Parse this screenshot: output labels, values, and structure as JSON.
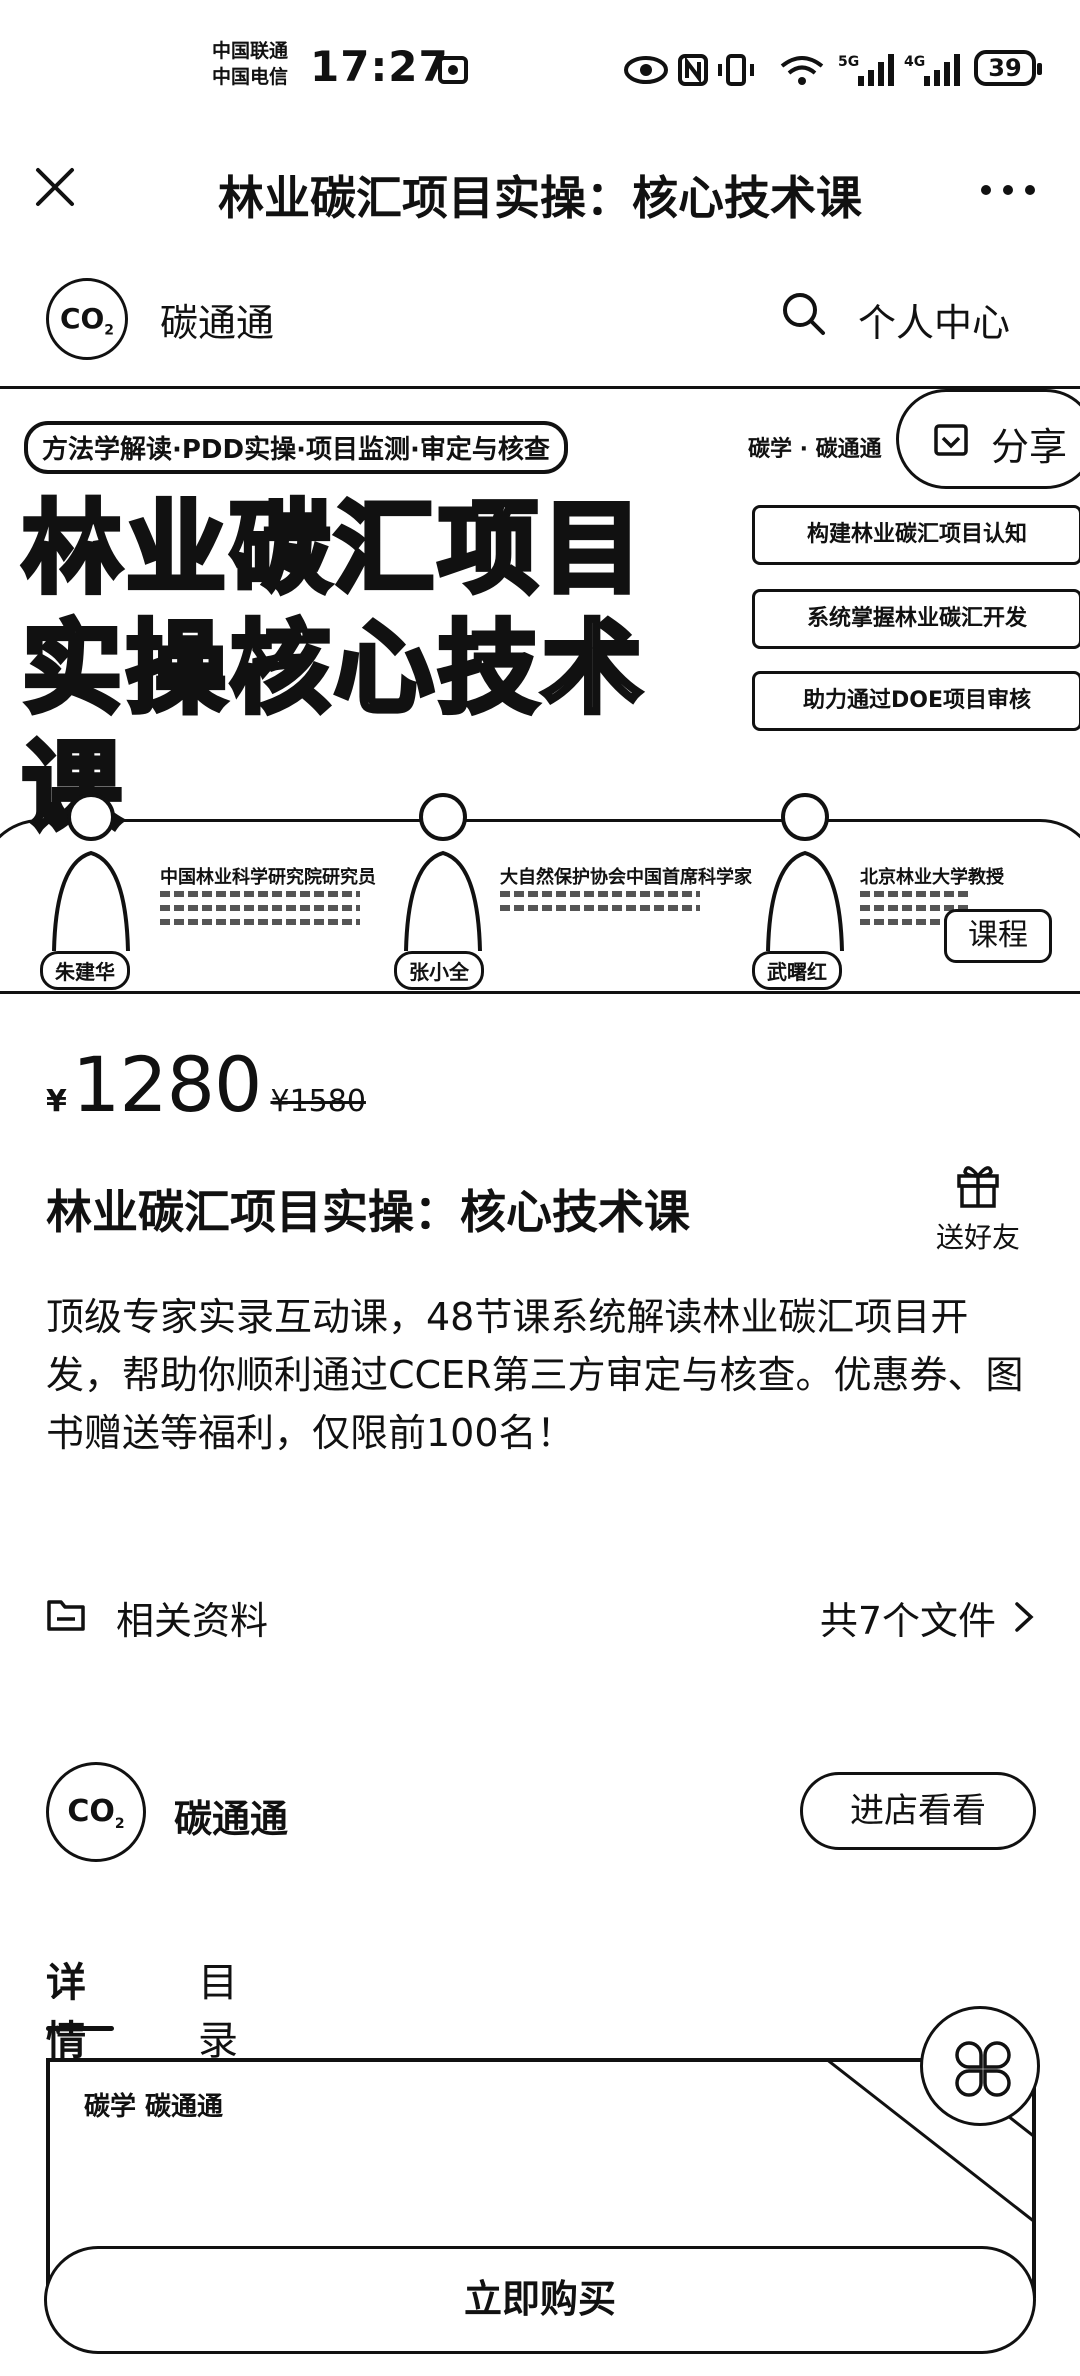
{
  "status_bar": {
    "carrier1": "中国联通",
    "carrier2": "中国电信",
    "time": "17:27",
    "battery": "39"
  },
  "nav": {
    "title": "林业碳汇项目实操：核心技术课"
  },
  "shop_header": {
    "shop_name": "碳通通",
    "personal_center": "个人中心"
  },
  "banner": {
    "tags": "方法学解读·PDD实操·项目监测·审定与核查",
    "brands": "碳学 · 碳通通",
    "share_label": "分享",
    "title": "林业碳汇项目实操核心技术课",
    "features": [
      "构建林业碳汇项目认知",
      "系统掌握林业碳汇开发",
      "助力通过DOE项目审核"
    ],
    "teachers": [
      {
        "name": "朱建华",
        "org": "中国林业科学研究院研究员"
      },
      {
        "name": "张小全",
        "org": "大自然保护协会中国首席科学家"
      },
      {
        "name": "武曙红",
        "org": "北京林业大学教授"
      }
    ],
    "course_button": "课程"
  },
  "price": {
    "currency": "¥",
    "current": "1280",
    "original": "¥1580"
  },
  "course": {
    "title": "林业碳汇项目实操：核心技术课",
    "gift_label": "送好友",
    "description": "顶级专家实录互动课，48节课系统解读林业碳汇项目开发，帮助你顺利通过CCER第三方审定与核查。优惠券、图书赠送等福利，仅限前100名！"
  },
  "materials": {
    "label": "相关资料",
    "count": "共7个文件"
  },
  "shop": {
    "name": "碳通通",
    "visit_button": "进店看看"
  },
  "tabs": [
    {
      "label": "详情",
      "active": true
    },
    {
      "label": "目录",
      "active": false
    }
  ],
  "detail": {
    "brands": "碳学  碳通通"
  },
  "buy_button": "立即购买",
  "colors": {
    "text": "#111111",
    "background": "#ffffff"
  }
}
